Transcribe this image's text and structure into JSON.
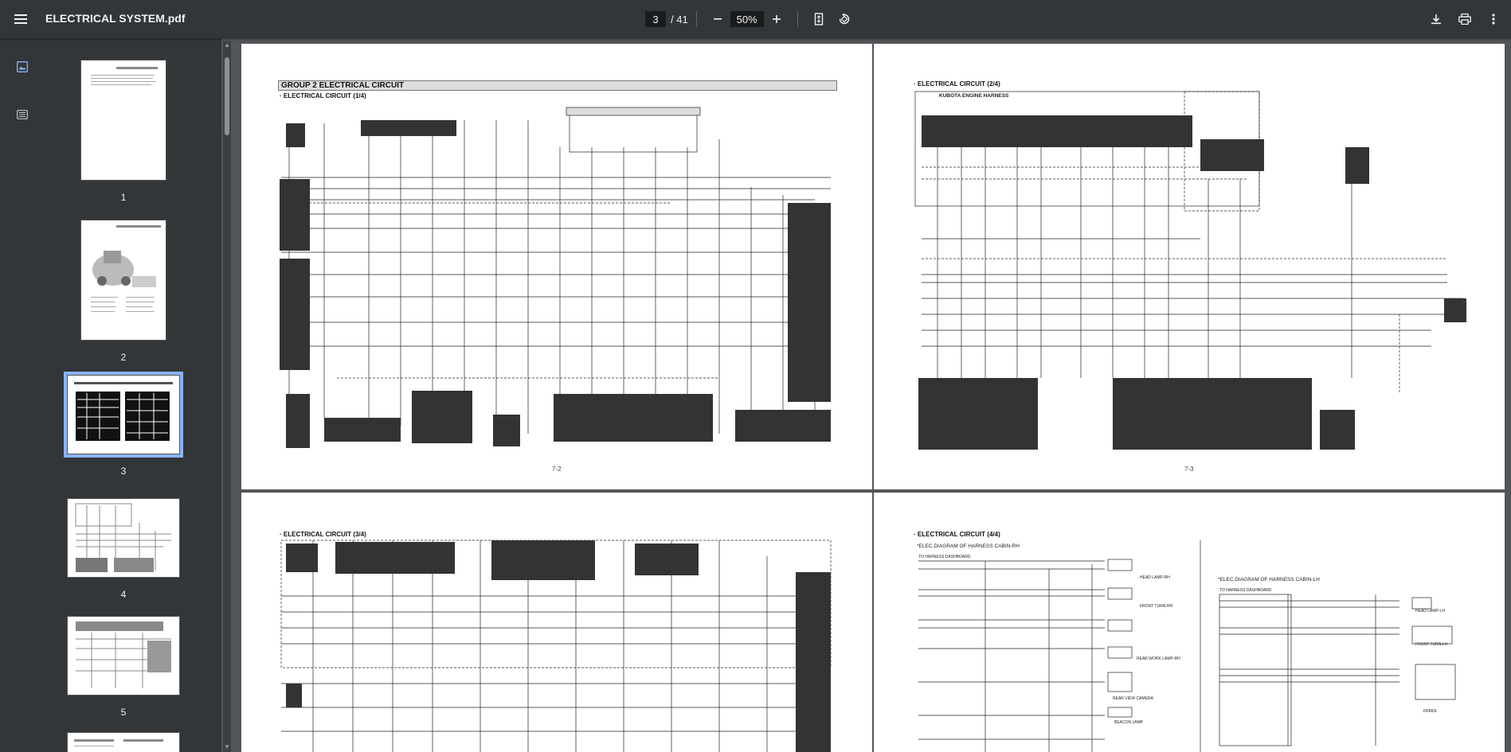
{
  "app": {
    "file_title": "ELECTRICAL SYSTEM.pdf",
    "current_page": "3",
    "total_pages": "/ 41",
    "zoom": "50%"
  },
  "toolbar": {
    "icons": [
      "menu-icon",
      "zoom-out-icon",
      "zoom-in-icon",
      "fit-page-icon",
      "rotate-icon",
      "download-icon",
      "print-icon",
      "more-vert-icon"
    ]
  },
  "sidebar": {
    "icons": [
      "thumbnails-icon",
      "outline-icon"
    ],
    "thumbnails": [
      {
        "label": "1"
      },
      {
        "label": "2"
      },
      {
        "label": "3",
        "selected": true
      },
      {
        "label": "4"
      },
      {
        "label": "5"
      }
    ]
  },
  "pages": {
    "p3": {
      "group_title": "GROUP  2  ELECTRICAL CIRCUIT",
      "section": "· ELECTRICAL CIRCUIT (1/4)",
      "page_number": "7-2"
    },
    "p4": {
      "section": "· ELECTRICAL CIRCUIT (2/4)",
      "harness": "KUBOTA  ENGINE  HARNESS",
      "page_number": "7-3"
    },
    "p5": {
      "section": "· ELECTRICAL CIRCUIT (3/4)"
    },
    "p6": {
      "section": "· ELECTRICAL CIRCUIT (4/4)",
      "diagram_rh": "*ELEC.DIAGRAM OF HARNESS CABIN-RH",
      "diagram_lh": "*ELEC.DIAGRAM OF HARNESS CABIN-LH",
      "to_harness_rh": "TO HARNESS DASHBOARD",
      "to_harness_lh": "TO HARNESS DASHBOARD",
      "labels_rh": [
        "HEAD LAMP-RH",
        "FRONT TURN-RH",
        "REAR WORK LAMP-RH",
        "REAR VIEW CAMERA",
        "BEACON LAMP"
      ],
      "labels_lh": [
        "HEAD LAMP-LH",
        "FRONT TURN-LH",
        "FRMOL"
      ]
    }
  }
}
